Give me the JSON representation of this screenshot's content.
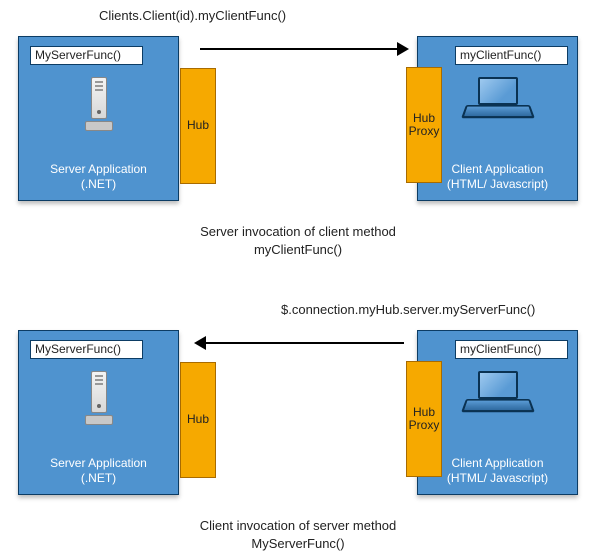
{
  "diagram1": {
    "callLabel": "Clients.Client(id).myClientFunc()",
    "serverFunc": "MyServerFunc()",
    "clientFunc": "myClientFunc()",
    "serverCaptionLine1": "Server Application",
    "serverCaptionLine2": "(.NET)",
    "clientCaptionLine1": "Client Application",
    "clientCaptionLine2": "(HTML/ Javascript)",
    "hubLeft": "Hub",
    "hubRightLine1": "Hub",
    "hubRightLine2": "Proxy",
    "captionLine1": "Server invocation of client method",
    "captionLine2": "myClientFunc()"
  },
  "diagram2": {
    "callLabel": "$.connection.myHub.server.myServerFunc()",
    "serverFunc": "MyServerFunc()",
    "clientFunc": "myClientFunc()",
    "serverCaptionLine1": "Server Application",
    "serverCaptionLine2": "(.NET)",
    "clientCaptionLine1": "Client Application",
    "clientCaptionLine2": "(HTML/ Javascript)",
    "hubLeft": "Hub",
    "hubRightLine1": "Hub",
    "hubRightLine2": "Proxy",
    "captionLine1": "Client invocation of server method",
    "captionLine2": "MyServerFunc()"
  }
}
